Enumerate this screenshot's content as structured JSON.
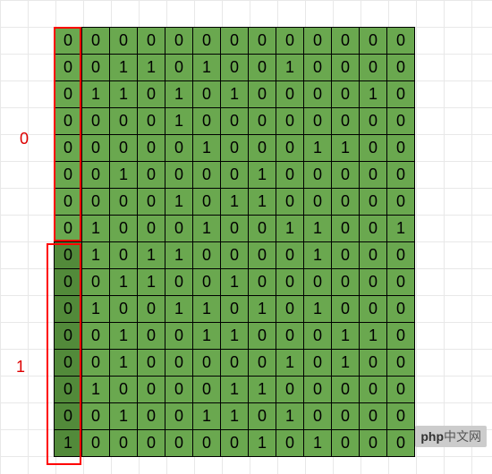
{
  "chart_data": {
    "type": "table",
    "title": "Binary matrix with row-group labels 0 and 1",
    "row_labels": [
      "0",
      "1"
    ],
    "group_sizes": [
      8,
      8
    ],
    "columns": 13,
    "matrix": [
      [
        0,
        0,
        0,
        0,
        0,
        0,
        0,
        0,
        0,
        0,
        0,
        0,
        0
      ],
      [
        0,
        0,
        1,
        1,
        0,
        1,
        0,
        0,
        1,
        0,
        0,
        0,
        0
      ],
      [
        0,
        1,
        1,
        0,
        1,
        0,
        1,
        0,
        0,
        0,
        0,
        1,
        0
      ],
      [
        0,
        0,
        0,
        0,
        1,
        0,
        0,
        0,
        0,
        0,
        0,
        0,
        0
      ],
      [
        0,
        0,
        0,
        0,
        0,
        1,
        0,
        0,
        0,
        1,
        1,
        0,
        0
      ],
      [
        0,
        0,
        1,
        0,
        0,
        0,
        0,
        1,
        0,
        0,
        0,
        0,
        0
      ],
      [
        0,
        0,
        0,
        0,
        1,
        0,
        1,
        1,
        0,
        0,
        0,
        0,
        0
      ],
      [
        0,
        1,
        0,
        0,
        0,
        1,
        0,
        0,
        1,
        1,
        0,
        0,
        1
      ],
      [
        0,
        1,
        0,
        1,
        1,
        0,
        0,
        0,
        0,
        1,
        0,
        0,
        0
      ],
      [
        0,
        0,
        1,
        1,
        0,
        0,
        1,
        0,
        0,
        0,
        0,
        0,
        0
      ],
      [
        0,
        1,
        0,
        0,
        1,
        1,
        0,
        1,
        0,
        1,
        0,
        0,
        0
      ],
      [
        0,
        0,
        1,
        0,
        0,
        1,
        1,
        0,
        0,
        0,
        1,
        1,
        0
      ],
      [
        0,
        0,
        1,
        0,
        0,
        0,
        0,
        0,
        1,
        0,
        1,
        0,
        0
      ],
      [
        0,
        1,
        0,
        0,
        0,
        0,
        1,
        1,
        0,
        0,
        0,
        0,
        0
      ],
      [
        0,
        0,
        1,
        0,
        0,
        1,
        1,
        0,
        1,
        0,
        0,
        0,
        0
      ],
      [
        1,
        0,
        0,
        0,
        0,
        0,
        0,
        1,
        0,
        1,
        0,
        0,
        0
      ]
    ]
  },
  "labels": {
    "group0": "0",
    "group1": "1"
  },
  "badge": {
    "prefix": "php",
    "suffix": "中文网"
  }
}
